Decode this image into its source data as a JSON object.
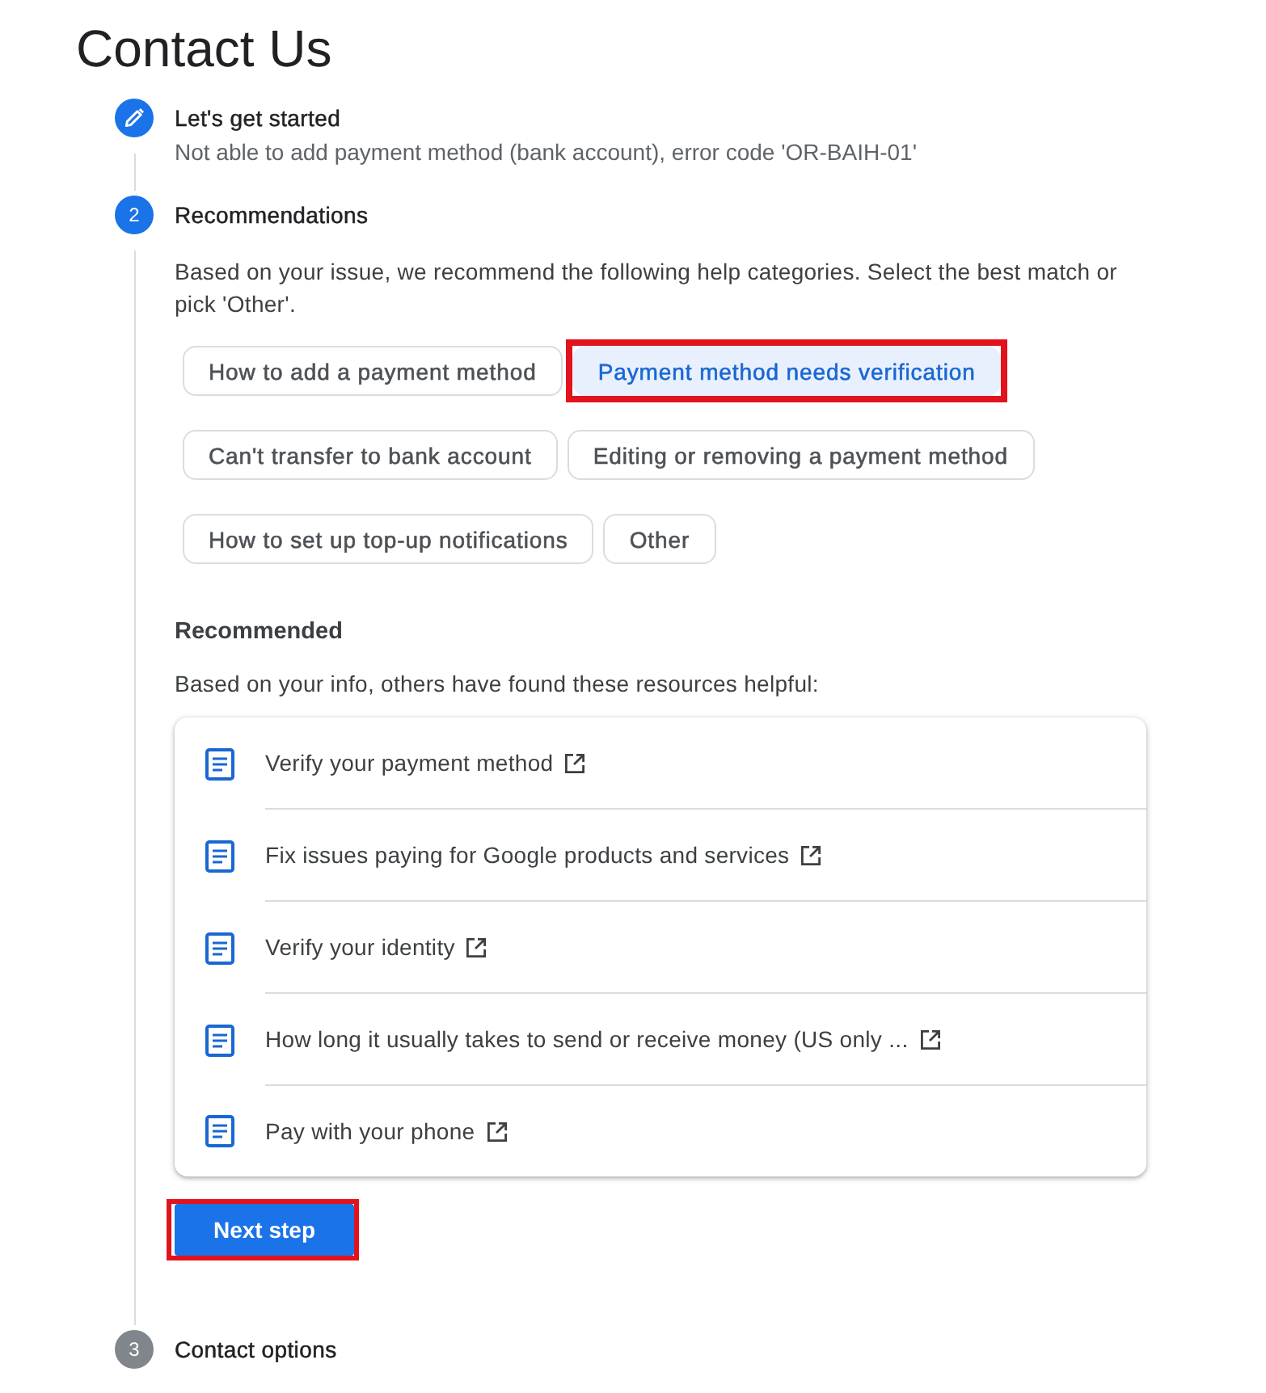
{
  "title": "Contact Us",
  "steps": [
    {
      "completed": true,
      "label": "Let's get started",
      "summary": "Not able to add payment method (bank account), error code 'OR-BAIH-01'"
    },
    {
      "completed": false,
      "active": true,
      "number": "2",
      "label": "Recommendations",
      "intro": "Based on your issue, we recommend the following help categories. Select the best match or pick 'Other'.",
      "chips": [
        {
          "label": "How to add a payment method",
          "selected": false,
          "highlighted": false
        },
        {
          "label": "Payment method needs verification",
          "selected": true,
          "highlighted": true
        },
        {
          "label": "Can't transfer to bank account",
          "selected": false,
          "highlighted": false
        },
        {
          "label": "Editing or removing a payment method",
          "selected": false,
          "highlighted": false
        },
        {
          "label": "How to set up top-up notifications",
          "selected": false,
          "highlighted": false
        },
        {
          "label": "Other",
          "selected": false,
          "highlighted": false
        }
      ],
      "recommended": {
        "heading": "Recommended",
        "intro": "Based on your info, others have found these resources helpful:",
        "resources": [
          {
            "title": "Verify your payment method"
          },
          {
            "title": "Fix issues paying for Google products and services"
          },
          {
            "title": "Verify your identity"
          },
          {
            "title": "How long it usually takes to send or receive money (US only ..."
          },
          {
            "title": "Pay with your phone"
          }
        ]
      },
      "next_button": {
        "label": "Next step",
        "highlighted": true
      }
    },
    {
      "completed": false,
      "active": false,
      "number": "3",
      "label": "Contact options"
    }
  ]
}
